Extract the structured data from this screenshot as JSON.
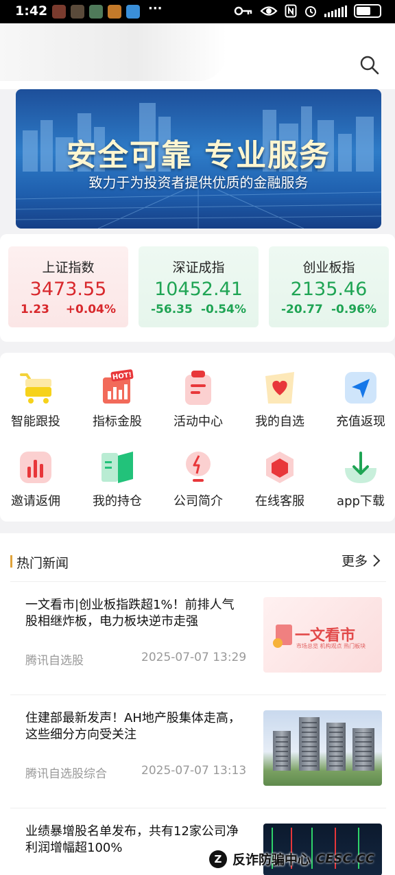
{
  "status_bar": {
    "time": "1:42",
    "overflow": "···",
    "icons": [
      "key-icon",
      "eye-icon",
      "nfc-icon",
      "alarm-icon",
      "signal-icon",
      "battery-icon"
    ]
  },
  "header": {
    "search_icon": "search-icon"
  },
  "banner": {
    "title": "安全可靠 专业服务",
    "subtitle": "致力于为投资者提供优质的金融服务"
  },
  "indices": [
    {
      "name": "上证指数",
      "value": "3473.55",
      "change": "1.23",
      "percent": "+0.04%",
      "trend": "up"
    },
    {
      "name": "深证成指",
      "value": "10452.41",
      "change": "-56.35",
      "percent": "-0.54%",
      "trend": "down"
    },
    {
      "name": "创业板指",
      "value": "2135.46",
      "change": "-20.77",
      "percent": "-0.96%",
      "trend": "down"
    }
  ],
  "menu": {
    "items": [
      {
        "label": "智能跟投",
        "icon": "cart-icon"
      },
      {
        "label": "指标金股",
        "icon": "hot-chart-icon"
      },
      {
        "label": "活动中心",
        "icon": "clipboard-icon"
      },
      {
        "label": "我的自选",
        "icon": "heart-icon"
      },
      {
        "label": "充值返现",
        "icon": "send-icon"
      },
      {
        "label": "邀请返佣",
        "icon": "bar-chart-icon"
      },
      {
        "label": "我的持仓",
        "icon": "book-icon"
      },
      {
        "label": "公司简介",
        "icon": "bulb-icon"
      },
      {
        "label": "在线客服",
        "icon": "hexagon-icon"
      },
      {
        "label": "app下载",
        "icon": "download-icon"
      }
    ]
  },
  "news": {
    "section_title": "热门新闻",
    "more_label": "更多",
    "items": [
      {
        "title": "一文看市|创业板指跌超1%！前排人气股相继炸板，电力板块逆市走强",
        "source": "腾讯自选股",
        "date": "2025-07-07 13:29",
        "thumb": {
          "title": "一文看市",
          "sub": "市场总览  机构观点  热门板块"
        }
      },
      {
        "title": "住建部最新发声！AH地产股集体走高，这些细分方向受关注",
        "source": "腾讯自选股综合",
        "date": "2025-07-07 13:13"
      },
      {
        "title": "业绩暴增股名单发布，共有12家公司净利润增幅超100%",
        "source": "",
        "date": ""
      }
    ]
  },
  "watermark": {
    "logo": "Z",
    "text": "反诈防骗中心",
    "domain": "CESC.CC"
  },
  "colors": {
    "up": "#d8282c",
    "down": "#1fa454",
    "accent": "#e0a33b"
  }
}
